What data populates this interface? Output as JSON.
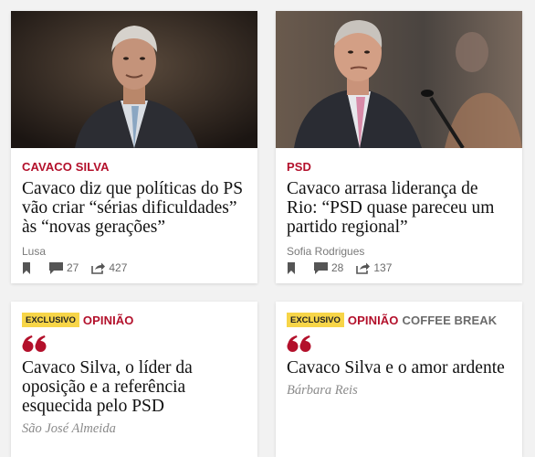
{
  "cards": [
    {
      "kicker": "CAVACO SILVA",
      "headline": "Cavaco diz que políticas do PS vão criar “sérias dificuldades” às “novas gerações”",
      "author": "Lusa",
      "comments": "27",
      "shares": "427",
      "image": "portrait-cavaco-silva-dark-background"
    },
    {
      "kicker": "PSD",
      "headline": "Cavaco arrasa liderança de Rio: “PSD quase pareceu um partido regional”",
      "author": "Sofia Rodrigues",
      "comments": "28",
      "shares": "137",
      "image": "cavaco-silva-at-microphone"
    },
    {
      "badge": "EXCLUSIVO",
      "kicker": "OPINIÃO",
      "headline": "Cavaco Silva, o líder da oposição e a referência esquecida pelo PSD",
      "author": "São José Almeida",
      "icon": "quote-icon"
    },
    {
      "badge": "EXCLUSIVO",
      "kicker": "OPINIÃO",
      "kicker2": "COFFEE BREAK",
      "headline": "Cavaco Silva e o amor ardente",
      "author": "Bárbara Reis",
      "icon": "quote-icon"
    }
  ],
  "colors": {
    "accent": "#b3102b",
    "badge": "#f7d548",
    "muted": "#7a7a7a"
  }
}
